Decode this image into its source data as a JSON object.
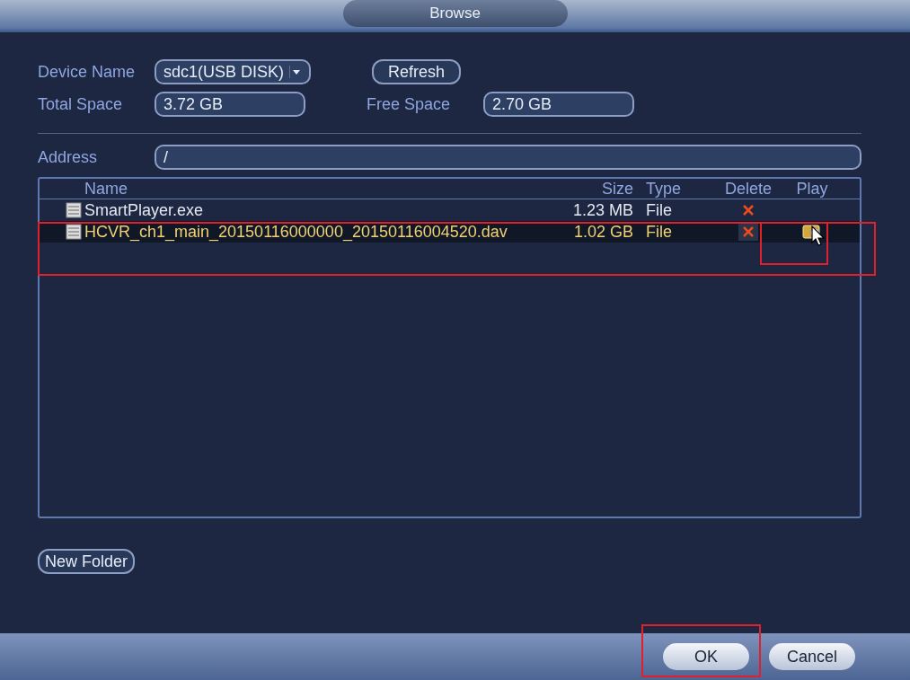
{
  "window": {
    "title": "Browse"
  },
  "device_name": {
    "label": "Device Name",
    "value": "sdc1(USB DISK)"
  },
  "refresh_button": "Refresh",
  "total_space": {
    "label": "Total Space",
    "value": "3.72 GB"
  },
  "free_space": {
    "label": "Free Space",
    "value": "2.70 GB"
  },
  "address": {
    "label": "Address",
    "value": "/"
  },
  "table": {
    "columns": [
      "Name",
      "Size",
      "Type",
      "Delete",
      "Play"
    ],
    "rows": [
      {
        "name": "SmartPlayer.exe",
        "size": "1.23 MB",
        "type": "File",
        "selected": false,
        "playable": false
      },
      {
        "name": "HCVR_ch1_main_20150116000000_20150116004520.dav",
        "size": "1.02 GB",
        "type": "File",
        "selected": true,
        "playable": true
      }
    ]
  },
  "new_folder_button": "New Folder",
  "buttons": [
    "OK",
    "Cancel"
  ]
}
